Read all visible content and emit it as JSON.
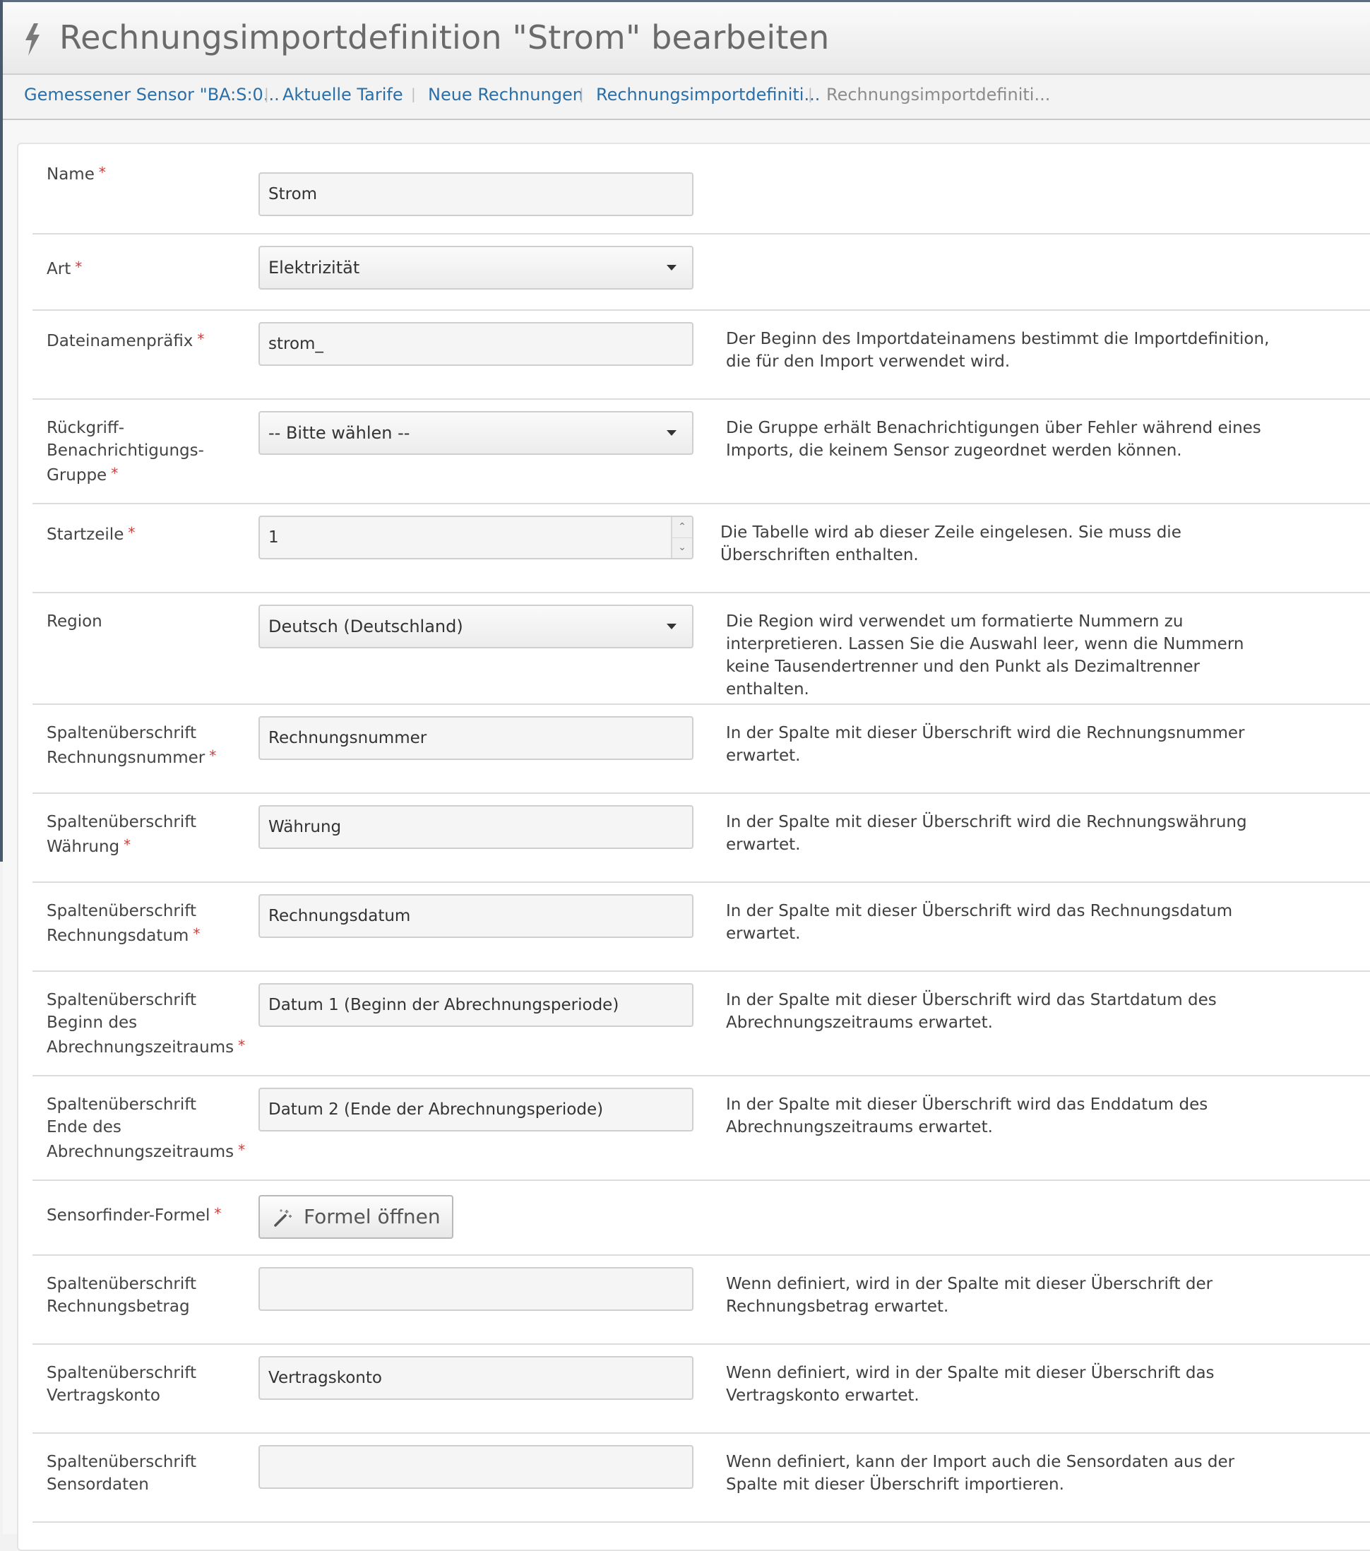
{
  "header": {
    "title": "Rechnungsimportdefinition \"Strom\" bearbeiten",
    "icon": "lightning-bolt-icon"
  },
  "breadcrumb": [
    {
      "label": "Gemessener Sensor \"BA:S:0...",
      "state": "link"
    },
    {
      "label": "Aktuelle Tarife",
      "state": "link"
    },
    {
      "label": "Neue Rechnungen",
      "state": "link"
    },
    {
      "label": "Rechnungsimportdefiniti...",
      "state": "link"
    },
    {
      "label": "Rechnungsimportdefiniti...",
      "state": "current"
    }
  ],
  "breadcrumb_separator": "|",
  "required_marker": "*",
  "colors": {
    "link": "#2a6fa8",
    "required": "#d23a3a",
    "title": "#6a6a6a"
  },
  "form": {
    "name": {
      "label": "Name",
      "value": "Strom"
    },
    "art": {
      "label": "Art",
      "value": "Elektrizität"
    },
    "prefix": {
      "label": "Dateinamenpräfix",
      "value": "strom_",
      "help": "Der Beginn des Importdateinamens bestimmt die Importdefinition, die für den Import verwendet wird."
    },
    "fallback_group": {
      "label": "Rückgriff-Benachrichtigungs-Gruppe",
      "value": "-- Bitte wählen --",
      "help": "Die Gruppe erhält Benachrichtigungen über Fehler während eines Imports, die keinem Sensor zugeordnet werden können."
    },
    "start_row": {
      "label": "Startzeile",
      "value": "1",
      "help": "Die Tabelle wird ab dieser Zeile eingelesen. Sie muss die Überschriften enthalten."
    },
    "region": {
      "label": "Region",
      "value": "Deutsch (Deutschland)",
      "help": "Die Region wird verwendet um formatierte Nummern zu interpretieren. Lassen Sie die Auswahl leer, wenn die Nummern keine Tausendertrenner und den Punkt als Dezimaltrenner enthalten."
    },
    "col_invoice_number": {
      "label": "Spaltenüberschrift Rechnungsnummer",
      "value": "Rechnungsnummer",
      "help": "In der Spalte mit dieser Überschrift wird die Rechnungsnummer erwartet."
    },
    "col_currency": {
      "label": "Spaltenüberschrift Währung",
      "value": "Währung",
      "help": "In der Spalte mit dieser Überschrift wird die Rechnungswährung erwartet."
    },
    "col_invoice_date": {
      "label": "Spaltenüberschrift Rechnungsdatum",
      "value": "Rechnungsdatum",
      "help": "In der Spalte mit dieser Überschrift wird das Rechnungsdatum erwartet."
    },
    "col_period_start": {
      "label": "Spaltenüberschrift Beginn des Abrechnungszeitraums",
      "value": "Datum 1 (Beginn der Abrechnungsperiode)",
      "help": "In der Spalte mit dieser Überschrift wird das Startdatum des Abrechnungszeitraums erwartet."
    },
    "col_period_end": {
      "label": "Spaltenüberschrift Ende des Abrechnungszeitraums",
      "value": "Datum 2 (Ende der Abrechnungsperiode)",
      "help": "In der Spalte mit dieser Überschrift wird das Enddatum des Abrechnungszeitraums erwartet."
    },
    "sensor_formula": {
      "label": "Sensorfinder-Formel",
      "button": "Formel öffnen"
    },
    "col_amount": {
      "label": "Spaltenüberschrift Rechnungsbetrag",
      "value": "",
      "help": "Wenn definiert, wird in der Spalte mit dieser Überschrift der Rechnungsbetrag erwartet."
    },
    "col_contract_account": {
      "label": "Spaltenüberschrift Vertragskonto",
      "value": "Vertragskonto",
      "help": "Wenn definiert, wird in der Spalte mit dieser Überschrift das Vertragskonto erwartet."
    },
    "col_sensor_data": {
      "label": "Spaltenüberschrift Sensordaten",
      "value": "",
      "help": "Wenn definiert, kann der Import auch die Sensordaten aus der Spalte mit dieser Überschrift importieren."
    }
  }
}
